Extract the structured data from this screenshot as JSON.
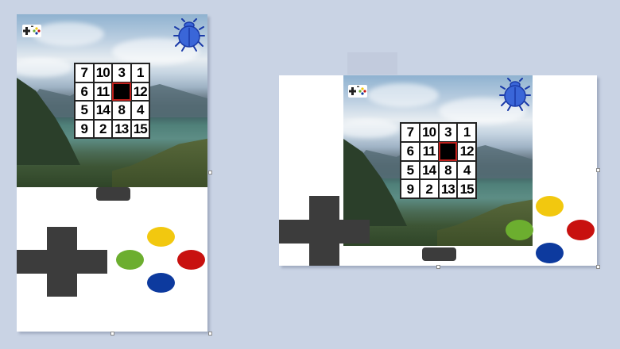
{
  "game": {
    "board": [
      [
        "7",
        "10",
        "3",
        "1"
      ],
      [
        "6",
        "11",
        "",
        "12"
      ],
      [
        "5",
        "14",
        "8",
        "4"
      ],
      [
        "9",
        "2",
        "13",
        "15"
      ]
    ]
  },
  "colors": {
    "background": "#c9d3e4",
    "button_yellow": "#f2c80f",
    "button_red": "#c8110f",
    "button_green": "#6cae2f",
    "button_blue": "#0d3a9e",
    "dpad": "#3c3c3c",
    "bug_icon": "#3a66d8",
    "blank_tile_border": "#c0201c"
  },
  "icons": {
    "gamepad": "gamepad-icon",
    "bug": "bug-icon"
  }
}
